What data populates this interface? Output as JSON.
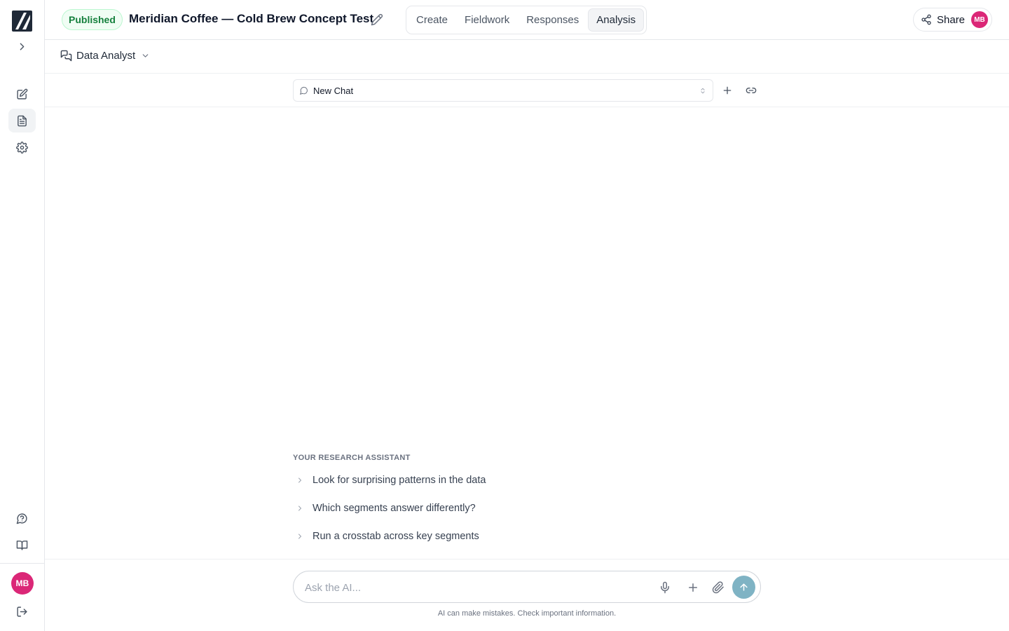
{
  "header": {
    "status": "Published",
    "title": "Meridian Coffee — Cold Brew Concept Test",
    "tabs": [
      {
        "label": "Create"
      },
      {
        "label": "Fieldwork"
      },
      {
        "label": "Responses"
      },
      {
        "label": "Analysis",
        "active": true
      }
    ],
    "share_label": "Share",
    "user_initials": "MB"
  },
  "sidebar": {
    "user_initials": "MB",
    "icons": [
      "chevron-right-icon",
      "edit-icon",
      "document-icon",
      "gear-icon",
      "help-icon",
      "book-icon",
      "logout-icon"
    ]
  },
  "agent": {
    "name": "Data Analyst"
  },
  "chat": {
    "selected": "New Chat"
  },
  "assistant": {
    "label": "YOUR RESEARCH ASSISTANT",
    "suggestions": [
      "Look for surprising patterns in the data",
      "Which segments answer differently?",
      "Run a crosstab across key segments"
    ]
  },
  "composer": {
    "placeholder": "Ask the AI...",
    "disclaimer": "AI can make mistakes. Check important information."
  },
  "colors": {
    "accent": "#7fb3c4",
    "avatar": "#db2777",
    "status_green": "#15803d"
  }
}
